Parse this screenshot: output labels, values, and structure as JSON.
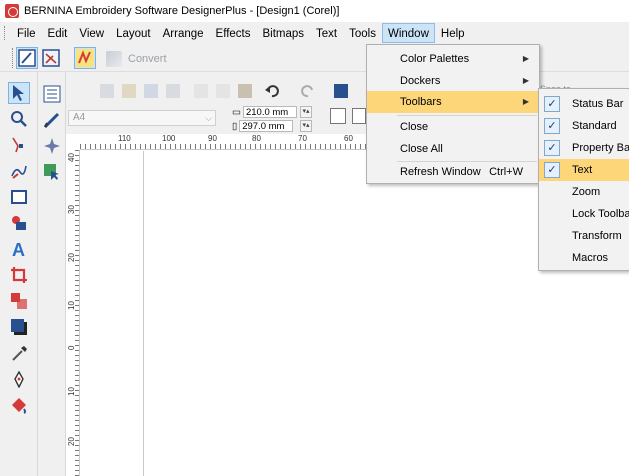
{
  "window": {
    "title": "BERNINA Embroidery Software DesignerPlus - [Design1 (Corel)]"
  },
  "menubar": {
    "items": [
      {
        "label": "File"
      },
      {
        "label": "Edit"
      },
      {
        "label": "View"
      },
      {
        "label": "Layout"
      },
      {
        "label": "Arrange"
      },
      {
        "label": "Effects"
      },
      {
        "label": "Bitmaps"
      },
      {
        "label": "Text"
      },
      {
        "label": "Tools"
      },
      {
        "label": "Window"
      },
      {
        "label": "Help"
      }
    ]
  },
  "toolbar": {
    "convert_label": "Convert"
  },
  "property_bar": {
    "paper": "A4",
    "width": "210.0 mm",
    "height": "297.0 mm",
    "snap_to": "Snap to"
  },
  "ruler": {
    "h_labels": [
      "110",
      "100",
      "90",
      "80",
      "70",
      "60"
    ],
    "v_labels": [
      "40",
      "30",
      "20",
      "10",
      "0",
      "10",
      "20"
    ]
  },
  "window_menu": {
    "items": [
      {
        "label": "Color Palettes",
        "submenu": true
      },
      {
        "label": "Dockers",
        "submenu": true
      },
      {
        "label": "Toolbars",
        "submenu": true,
        "highlighted": true
      },
      {
        "label": "Close"
      },
      {
        "label": "Close All"
      },
      {
        "label": "Refresh Window",
        "shortcut": "Ctrl+W"
      }
    ]
  },
  "toolbars_submenu": {
    "items": [
      {
        "label": "Status Bar",
        "checked": true
      },
      {
        "label": "Standard",
        "checked": true
      },
      {
        "label": "Property Bar",
        "checked": true
      },
      {
        "label": "Text",
        "checked": true,
        "highlighted": true
      },
      {
        "label": "Zoom",
        "checked": false
      },
      {
        "label": "Lock Toolbars",
        "checked": false
      },
      {
        "label": "Transform",
        "checked": false
      },
      {
        "label": "Macros",
        "checked": false
      }
    ]
  },
  "check_glyph": "✓",
  "submenu_arrow": "▶",
  "colors": {
    "menu_highlight": "#fcd679",
    "selected_tool": "#cce4f7",
    "app_icon": "#d43a3a"
  }
}
